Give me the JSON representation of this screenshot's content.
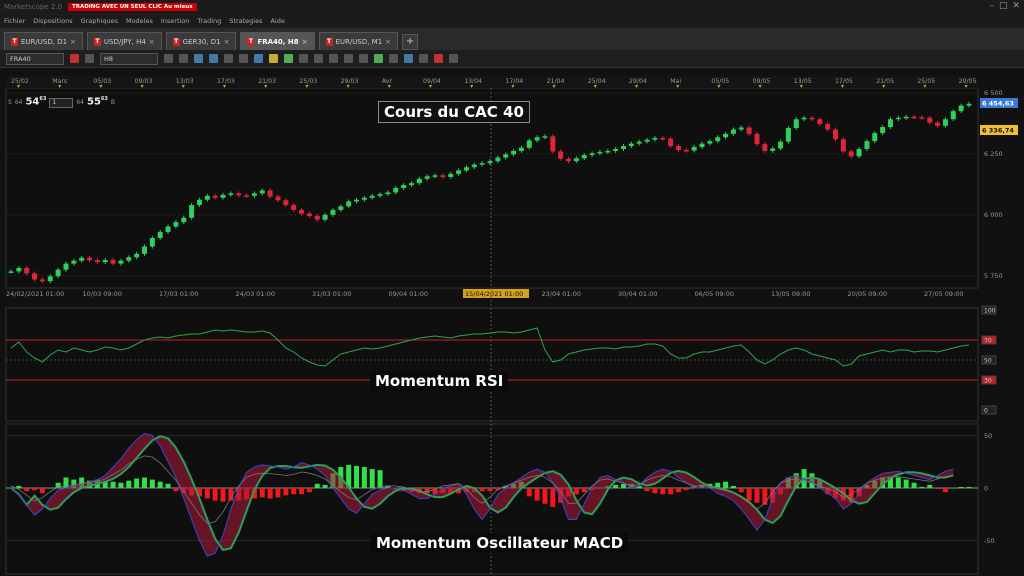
{
  "window": {
    "app_title": "Marketscope 2.0",
    "promo_banner": "TRADING AVEC UN SEUL CLIC Au mieux",
    "controls": [
      "–",
      "□",
      "✕"
    ]
  },
  "menu": [
    "Fichier",
    "Dispositions",
    "Graphiques",
    "Modeles",
    "Insertion",
    "Trading",
    "Strategies",
    "Aide"
  ],
  "tabs": [
    {
      "label": "EUR/USD, D1",
      "active": false
    },
    {
      "label": "USD/JPY, H4",
      "active": false
    },
    {
      "label": "GER30, D1",
      "active": false
    },
    {
      "label": "FRA40, H8",
      "active": true
    },
    {
      "label": "EUR/USD, M1",
      "active": false
    }
  ],
  "toolbar": {
    "instrument": "FRA40",
    "timeframe": "H8"
  },
  "trade": {
    "lot_small_left": "64",
    "sell_big": "54",
    "sell_sup": "63",
    "qty": "1",
    "lot_small_right": "64",
    "buy_big": "55",
    "buy_sup": "63",
    "sell_letter": "S",
    "buy_letter": "B"
  },
  "annotations": {
    "price_title": "Cours du CAC 40",
    "rsi_title": "Momentum RSI",
    "macd_title": "Momentum Oscillateur MACD"
  },
  "chart_data": [
    {
      "type": "candlestick",
      "instrument": "FRA40",
      "timeframe": "H8",
      "top_axis_labels": [
        "25/02",
        "Mars",
        "05/03",
        "09/03",
        "13/03",
        "17/03",
        "21/03",
        "25/03",
        "29/03",
        "Avr",
        "09/04",
        "13/04",
        "17/04",
        "21/04",
        "25/04",
        "29/04",
        "Mai",
        "05/05",
        "09/05",
        "13/05",
        "17/05",
        "21/05",
        "25/05",
        "29/05"
      ],
      "bottom_axis_labels": [
        "24/02/2021 01:00",
        "10/03 09:00",
        "17/03 01:00",
        "24/03 01:00",
        "31/03 01:00",
        "09/04 01:00",
        "15/04/2021 01:00",
        "23/04 01:00",
        "30/04 01:00",
        "06/05 09:00",
        "13/05 09:00",
        "20/05 09:00",
        "27/05 09:00"
      ],
      "highlighted_x_label": "15/04/2021 01:00",
      "y_ticks": [
        5750,
        6000,
        6250,
        6500
      ],
      "ylim": [
        5700,
        6520
      ],
      "price_tags": [
        {
          "value": "6 454,63",
          "color": "#3a7bd5"
        },
        {
          "value": "6 336,74",
          "color": "#f0c030"
        }
      ],
      "close_series": [
        5768,
        5782,
        5760,
        5735,
        5728,
        5748,
        5775,
        5800,
        5812,
        5824,
        5814,
        5806,
        5815,
        5800,
        5812,
        5826,
        5840,
        5870,
        5905,
        5930,
        5952,
        5970,
        5988,
        6040,
        6062,
        6078,
        6070,
        6082,
        6088,
        6080,
        6078,
        6088,
        6100,
        6075,
        6060,
        6040,
        6020,
        6005,
        5995,
        5980,
        6000,
        6020,
        6035,
        6055,
        6062,
        6070,
        6078,
        6085,
        6092,
        6110,
        6122,
        6130,
        6148,
        6158,
        6162,
        6155,
        6168,
        6182,
        6195,
        6206,
        6212,
        6220,
        6235,
        6248,
        6262,
        6275,
        6305,
        6318,
        6322,
        6260,
        6230,
        6220,
        6232,
        6245,
        6252,
        6258,
        6262,
        6270,
        6282,
        6292,
        6300,
        6308,
        6315,
        6312,
        6282,
        6266,
        6264,
        6278,
        6292,
        6302,
        6318,
        6332,
        6350,
        6358,
        6332,
        6290,
        6262,
        6272,
        6300,
        6356,
        6392,
        6398,
        6392,
        6372,
        6350,
        6310,
        6260,
        6240,
        6270,
        6302,
        6335,
        6360,
        6392,
        6398,
        6402,
        6400,
        6398,
        6378,
        6365,
        6392,
        6425,
        6448,
        6455
      ]
    },
    {
      "type": "line",
      "name": "RSI",
      "y_ticks": [
        0,
        30,
        50,
        70,
        100
      ],
      "ylim": [
        0,
        100
      ],
      "levels": [
        30,
        50,
        70
      ],
      "values": [
        62,
        68,
        58,
        52,
        48,
        55,
        60,
        58,
        62,
        60,
        58,
        60,
        63,
        62,
        60,
        62,
        66,
        70,
        72,
        73,
        72,
        74,
        75,
        76,
        76,
        78,
        80,
        79,
        80,
        79,
        78,
        78,
        79,
        77,
        70,
        62,
        58,
        52,
        48,
        45,
        44,
        50,
        56,
        58,
        60,
        62,
        61,
        62,
        64,
        66,
        68,
        70,
        72,
        73,
        74,
        73,
        72,
        74,
        75,
        76,
        76,
        77,
        78,
        78,
        77,
        78,
        80,
        82,
        60,
        48,
        50,
        56,
        58,
        60,
        61,
        62,
        62,
        61,
        63,
        63,
        64,
        66,
        66,
        64,
        56,
        52,
        52,
        56,
        58,
        58,
        60,
        62,
        64,
        65,
        58,
        50,
        46,
        50,
        56,
        60,
        62,
        60,
        56,
        54,
        52,
        50,
        44,
        46,
        54,
        56,
        58,
        60,
        58,
        60,
        60,
        58,
        59,
        59,
        58,
        60,
        62,
        64,
        65
      ]
    },
    {
      "type": "bar+line",
      "name": "MACD",
      "y_ticks": [
        -50,
        0,
        50
      ],
      "ylim": [
        -70,
        55
      ],
      "histogram": [
        0,
        2,
        -3,
        -2,
        -5,
        0,
        5,
        10,
        8,
        10,
        7,
        8,
        6,
        6,
        5,
        7,
        9,
        10,
        8,
        6,
        4,
        -3,
        -5,
        -7,
        -8,
        -10,
        -12,
        -13,
        -12,
        -12,
        -11,
        -10,
        -9,
        -10,
        -9,
        -7,
        -6,
        -6,
        -4,
        4,
        3,
        14,
        20,
        22,
        21,
        20,
        18,
        17,
        2,
        -2,
        -3,
        -4,
        -5,
        -5,
        -6,
        -5,
        -5,
        -5,
        -4,
        -4,
        -3,
        -3,
        -2,
        2,
        4,
        6,
        -8,
        -12,
        -15,
        -18,
        -14,
        -8,
        -6,
        -4,
        -2,
        0,
        2,
        3,
        4,
        4,
        2,
        -3,
        -5,
        -6,
        -6,
        -4,
        -2,
        2,
        3,
        4,
        5,
        6,
        2,
        -4,
        -12,
        -14,
        -16,
        -14,
        -6,
        10,
        14,
        18,
        14,
        8,
        -6,
        -10,
        -12,
        -14,
        -8,
        3,
        7,
        10,
        11,
        10,
        8,
        5,
        1,
        3,
        -1,
        -4,
        0,
        1,
        1
      ],
      "fast_line": [
        0,
        -6,
        -16,
        -26,
        -20,
        -10,
        -2,
        0,
        2,
        4,
        6,
        8,
        12,
        20,
        28,
        38,
        46,
        52,
        50,
        40,
        25,
        10,
        -10,
        -30,
        -50,
        -65,
        -62,
        -45,
        -20,
        0,
        15,
        20,
        22,
        21,
        20,
        18,
        20,
        24,
        22,
        18,
        12,
        0,
        -10,
        -20,
        -24,
        -15,
        -6,
        -2,
        0,
        0,
        -2,
        -6,
        -10,
        -10,
        -6,
        0,
        2,
        4,
        -6,
        -20,
        -30,
        -20,
        -6,
        0,
        5,
        10,
        15,
        18,
        15,
        5,
        -10,
        -30,
        -30,
        -15,
        0,
        10,
        12,
        8,
        5,
        0,
        2,
        10,
        15,
        18,
        16,
        10,
        5,
        0,
        0,
        0,
        -5,
        -8,
        -12,
        -20,
        -30,
        -40,
        -30,
        -10,
        5,
        10,
        12,
        8,
        5,
        0,
        -5,
        -10,
        -20,
        -15,
        -5,
        5,
        10,
        14,
        15,
        16,
        14,
        12,
        10,
        8,
        12,
        16,
        18
      ]
    }
  ]
}
